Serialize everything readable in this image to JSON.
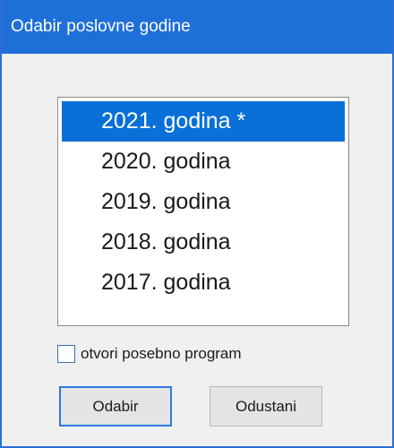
{
  "window": {
    "title": "Odabir poslovne godine"
  },
  "year_list": {
    "items": [
      {
        "label": "2021. godina *",
        "selected": true
      },
      {
        "label": "2020. godina",
        "selected": false
      },
      {
        "label": "2019. godina",
        "selected": false
      },
      {
        "label": "2018. godina",
        "selected": false
      },
      {
        "label": "2017. godina",
        "selected": false
      }
    ]
  },
  "options": {
    "open_separately_label": "otvori posebno program",
    "open_separately_checked": false
  },
  "buttons": {
    "select_label": "Odabir",
    "cancel_label": "Odustani"
  },
  "colors": {
    "titlebar": "#1f6fd9",
    "selection": "#0a70d8",
    "default_button_border": "#2a7be4"
  }
}
